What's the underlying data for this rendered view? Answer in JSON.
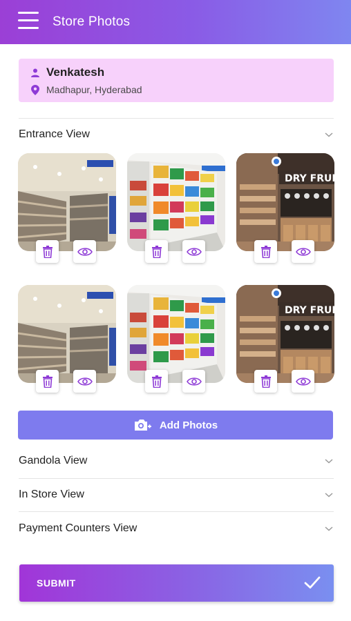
{
  "header": {
    "title": "Store Photos"
  },
  "store": {
    "name": "Venkatesh",
    "location": "Madhapur, Hyderabad"
  },
  "sections": [
    {
      "title": "Entrance View",
      "expanded": true
    },
    {
      "title": "Gandola View",
      "expanded": false
    },
    {
      "title": "In Store View",
      "expanded": false
    },
    {
      "title": "Payment Counters View",
      "expanded": false
    }
  ],
  "photos": [
    {
      "scene": "supermarket-aisle"
    },
    {
      "scene": "snack-shelves"
    },
    {
      "scene": "dry-fruits-store",
      "sign": "DRY FRUITS"
    },
    {
      "scene": "supermarket-aisle"
    },
    {
      "scene": "snack-shelves"
    },
    {
      "scene": "dry-fruits-store",
      "sign": "DRY FRUITS"
    }
  ],
  "add_photos_label": "Add Photos",
  "submit_label": "SUBMIT",
  "colors": {
    "header_start": "#9b3fd6",
    "header_end": "#7f86f0",
    "store_card_bg": "#f7d1fb",
    "icon_purple": "#8e3ad6",
    "add_photos_bg": "#7e7bee"
  }
}
